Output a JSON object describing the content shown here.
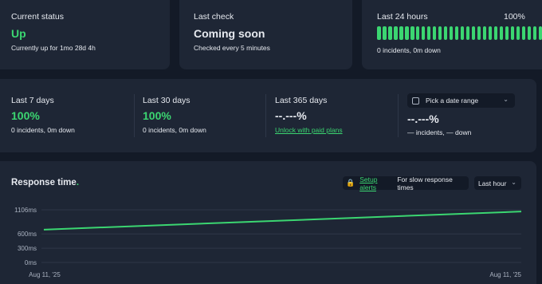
{
  "status": {
    "label": "Current status",
    "value": "Up",
    "detail": "Currently up for 1mo 28d 4h"
  },
  "check": {
    "label": "Last check",
    "value": "Coming soon",
    "detail": "Checked every 5 minutes"
  },
  "last24": {
    "label": "Last 24 hours",
    "percent": "100%",
    "bar_count": 30,
    "detail": "0 incidents, 0m down",
    "bar_color": "#3bd671"
  },
  "periods": [
    {
      "label": "Last 7 days",
      "value": "100%",
      "detail": "0 incidents, 0m down"
    },
    {
      "label": "Last 30 days",
      "value": "100%",
      "detail": "0 incidents, 0m down"
    },
    {
      "label": "Last 365 days",
      "value": "--.---%",
      "link": "Unlock with paid plans"
    }
  ],
  "custom_range": {
    "picker_label": "Pick a date range",
    "value": "--.---%",
    "detail": "— incidents, — down"
  },
  "response": {
    "title": "Response time",
    "title_dot": ".",
    "alert_link": "Setup alerts",
    "alert_text": "For slow response times",
    "range_value": "Last hour"
  },
  "chart_data": {
    "type": "line",
    "x": [
      "Aug 11, '25",
      "Aug 11, '25"
    ],
    "series": [
      {
        "values": [
          690,
          1070
        ]
      }
    ],
    "y_ticks": [
      "0ms",
      "300ms",
      "600ms",
      "1106ms"
    ],
    "y_tick_values": [
      0,
      300,
      600,
      1106
    ],
    "ylim": [
      0,
      1106
    ],
    "x_tick_labels": [
      "Aug 11, '25",
      "Aug 11, '25"
    ],
    "grid": true,
    "line_color": "#3bd671"
  },
  "colors": {
    "accent": "#3bd671",
    "card": "#1e2635",
    "background": "#131a27",
    "lock": "#f2a33a"
  }
}
